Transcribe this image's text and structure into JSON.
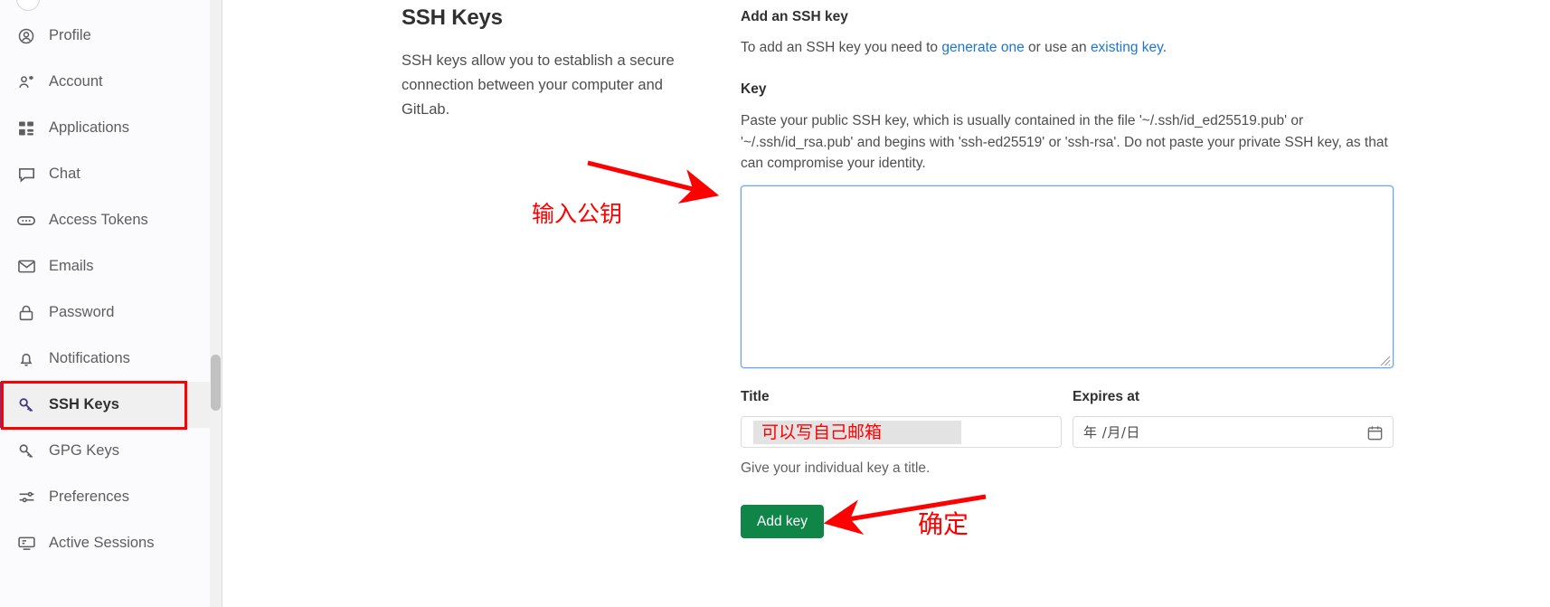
{
  "sidebar": {
    "scrollbar": "vertical-scrollbar",
    "items": [
      {
        "id": "profile",
        "label": "Profile",
        "icon": "user-circle-icon",
        "active": false
      },
      {
        "id": "account",
        "label": "Account",
        "icon": "account-gear-icon",
        "active": false
      },
      {
        "id": "applications",
        "label": "Applications",
        "icon": "applications-grid-icon",
        "active": false
      },
      {
        "id": "chat",
        "label": "Chat",
        "icon": "chat-bubble-icon",
        "active": false
      },
      {
        "id": "access-tokens",
        "label": "Access Tokens",
        "icon": "token-pill-icon",
        "active": false
      },
      {
        "id": "emails",
        "label": "Emails",
        "icon": "envelope-icon",
        "active": false
      },
      {
        "id": "password",
        "label": "Password",
        "icon": "lock-icon",
        "active": false
      },
      {
        "id": "notifications",
        "label": "Notifications",
        "icon": "bell-icon",
        "active": false
      },
      {
        "id": "ssh-keys",
        "label": "SSH Keys",
        "icon": "key-icon",
        "active": true
      },
      {
        "id": "gpg-keys",
        "label": "GPG Keys",
        "icon": "key-icon",
        "active": false
      },
      {
        "id": "preferences",
        "label": "Preferences",
        "icon": "sliders-icon",
        "active": false
      },
      {
        "id": "active-sessions",
        "label": "Active Sessions",
        "icon": "monitor-icon",
        "active": false
      }
    ]
  },
  "description": {
    "title": "SSH Keys",
    "body": "SSH keys allow you to establish a secure connection between your computer and GitLab."
  },
  "form": {
    "heading": "Add an SSH key",
    "intro_before": "To add an SSH key you need to ",
    "intro_link1": "generate one",
    "intro_middle": " or use an ",
    "intro_link2": "existing key",
    "intro_after": ".",
    "key_label": "Key",
    "key_help": "Paste your public SSH key, which is usually contained in the file '~/.ssh/id_ed25519.pub' or '~/.ssh/id_rsa.pub' and begins with 'ssh-ed25519' or 'ssh-rsa'. Do not paste your private SSH key, as that can compromise your identity.",
    "key_textarea_value": "",
    "title_label": "Title",
    "title_value": "可以写自己邮箱",
    "title_hint": "Give your individual key a title.",
    "expires_label": "Expires at",
    "expires_placeholder": "年 /月/日",
    "calendar_icon": "calendar-icon",
    "submit_label": "Add key"
  },
  "annotations": {
    "key_note": "输入公钥",
    "confirm_note": "确定",
    "color": "#ff0000",
    "arrow_to_textarea": "red-arrow-pointing-to-key-textarea",
    "arrow_to_button": "red-arrow-pointing-to-add-key-button",
    "highlight_box": "red-box-around-ssh-keys-nav-item"
  }
}
